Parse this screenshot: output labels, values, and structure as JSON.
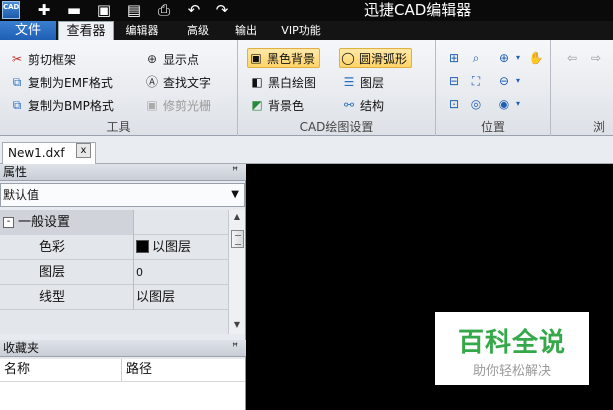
{
  "app": {
    "title": "迅捷CAD编辑器",
    "logo_text": "CAD"
  },
  "menu": {
    "file_label": "文件",
    "tabs": [
      "查看器",
      "编辑器",
      "高级",
      "输出",
      "VIP功能"
    ]
  },
  "ribbon": {
    "tools": {
      "label": "工具",
      "buttons": [
        "剪切框架",
        "复制为EMF格式",
        "复制为BMP格式",
        "显示点",
        "查找文字",
        "修剪光栅"
      ]
    },
    "cad_settings": {
      "label": "CAD绘图设置",
      "buttons": [
        "黑色背景",
        "圆滑弧形",
        "黑白绘图",
        "图层",
        "背景色",
        "结构"
      ]
    },
    "position": {
      "label": "位置"
    },
    "browse": {
      "label": "浏"
    }
  },
  "document": {
    "tab_label": "New1.dxf",
    "close_glyph": "x"
  },
  "properties": {
    "title": "属性",
    "pin_glyph": "ꟸ",
    "dropdown_value": "默认值",
    "group_expander": "-",
    "group_title": "一般设置",
    "rows": [
      {
        "key": "色彩",
        "value": "以图层",
        "has_swatch": true
      },
      {
        "key": "图层",
        "value": "0"
      },
      {
        "key": "线型",
        "value": "以图层"
      }
    ]
  },
  "favorites": {
    "title": "收藏夹",
    "columns": [
      "名称",
      "路径"
    ]
  },
  "watermark": {
    "main": "百科全说",
    "sub": "助你轻松解决"
  },
  "colors": {
    "canvas": "#000000",
    "accent_tab": "#2a6fc4",
    "highlight": "#ffd467",
    "watermark_green": "#35a84a"
  }
}
